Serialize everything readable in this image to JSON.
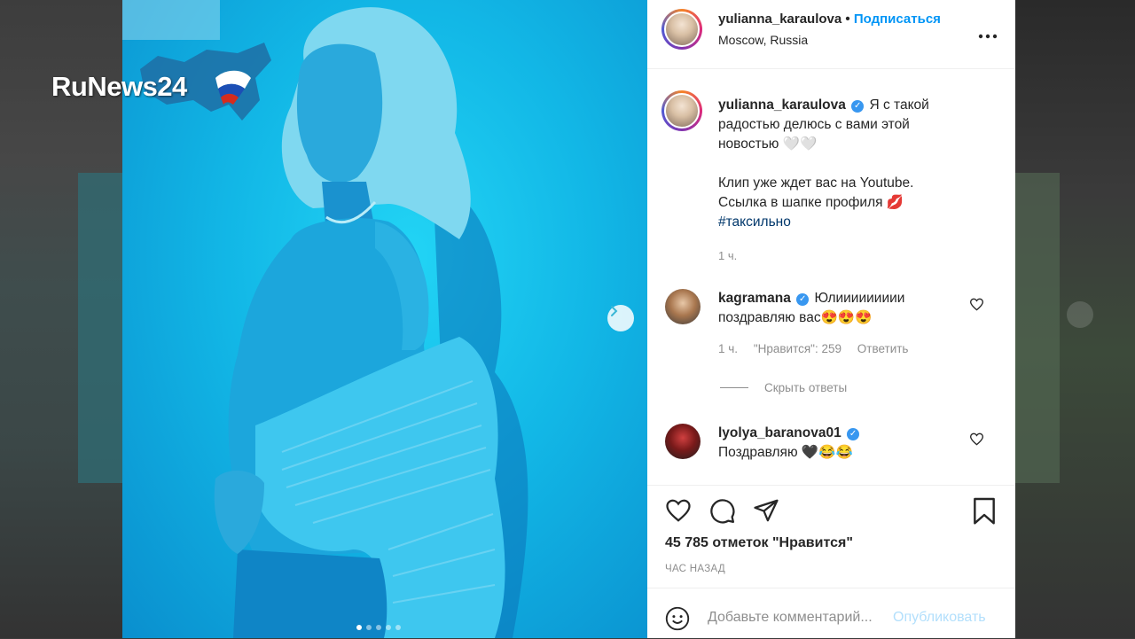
{
  "watermark": {
    "logo_text": "RuNews24"
  },
  "post": {
    "photo": {
      "slide_count": 5,
      "active_slide": 1
    },
    "header": {
      "username": "yulianna_karaulova",
      "separator": "•",
      "follow_label": "Подписаться",
      "location": "Moscow, Russia",
      "more_label": "•••"
    },
    "caption": {
      "username": "yulianna_karaulova",
      "line1": "Я с такой радостью делюсь с вами этой новостью 🤍🤍",
      "line2": "Клип уже ждет вас на Youtube. Ссылка в шапке профиля 💋",
      "hashtag": "#таксильно",
      "time": "1 ч."
    },
    "comments": [
      {
        "username": "kagramana",
        "text": "Юлиииииииии поздравляю вас😍😍😍",
        "time": "1 ч.",
        "likes": "\"Нравится\": 259",
        "reply_label": "Ответить"
      },
      {
        "username": "lyolya_baranova01",
        "text": "Поздравляю 🖤😂😂"
      }
    ],
    "hide_replies_label": "Скрыть ответы",
    "likes_text": "45 785 отметок \"Нравится\"",
    "time_ago": "ЧАС НАЗАД",
    "comment_box": {
      "placeholder": "Добавьте комментарий...",
      "post_label": "Опубликовать"
    },
    "colors": {
      "accent": "#0095f6",
      "photo_tint": "#12b7e6",
      "text": "#262626",
      "muted": "#8e8e8e"
    }
  }
}
